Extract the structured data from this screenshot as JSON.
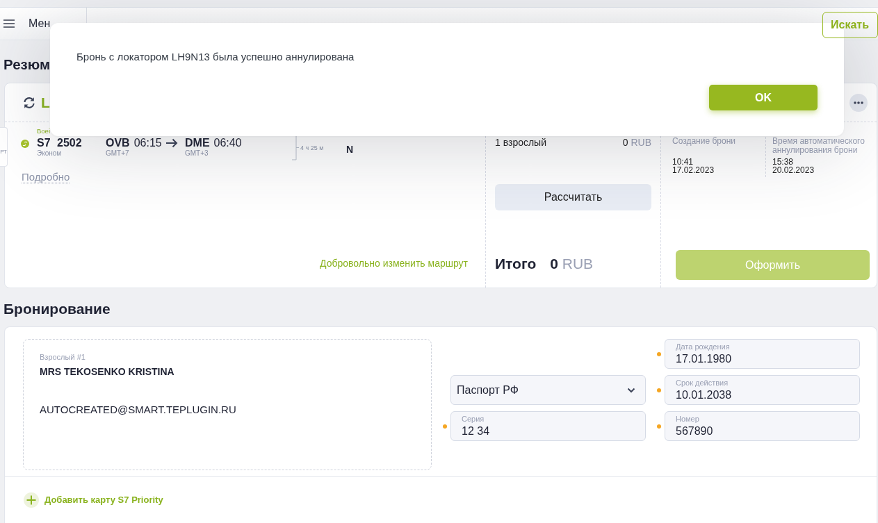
{
  "header": {
    "menu_label": "Мен",
    "search_button": "Искать"
  },
  "dialog": {
    "message": "Бронь с локатором LH9N13 была успешно аннулирована",
    "ok_button": "OK"
  },
  "summary": {
    "heading": "Резюм",
    "side_card_text": "РТ",
    "locator": "L",
    "flight": {
      "aircraft": "Boei",
      "flight_number": "S7 2502",
      "cabin": "Эконом",
      "departure": {
        "code": "OVB",
        "time": "06:15",
        "timezone": "GMT+7"
      },
      "arrival": {
        "code": "DME",
        "time": "06:40",
        "timezone": "GMT+3"
      },
      "duration": "4 ч 25 м",
      "fare_class": "N"
    },
    "details_link": "Подробно",
    "change_route_link": "Добровольно изменить маршрут",
    "fare_rows": [
      {
        "label": "1 взрослый",
        "amount": "0",
        "currency": "RUB"
      }
    ],
    "calculate_button": "Рассчитать",
    "total": {
      "label": "Итого",
      "amount": "0",
      "currency": "RUB"
    },
    "dates": [
      {
        "label": "Создание брони",
        "time": "10:41",
        "date": "17.02.2023"
      },
      {
        "label": "Время автоматического аннулирования брони",
        "time": "15:38",
        "date": "20.02.2023"
      }
    ],
    "issue_button": {
      "label": "Оформить",
      "disabled": true
    }
  },
  "booking": {
    "heading": "Бронирование",
    "passenger": {
      "category": "Взрослый #1",
      "name": "MRS TEKOSENKO KRISTINA",
      "email": "AUTOCREATED@SMART.TEPLUGIN.RU"
    },
    "left_fields": [
      {
        "kind": "select",
        "value": "Паспорт РФ",
        "required": false
      },
      {
        "kind": "text",
        "label": "Серия",
        "value": "12 34",
        "required": true
      }
    ],
    "right_fields": [
      {
        "kind": "text",
        "label": "Дата рождения",
        "value": "17.01.1980",
        "required": true
      },
      {
        "kind": "text",
        "label": "Срок действия",
        "value": "10.01.2038",
        "required": true
      },
      {
        "kind": "text",
        "label": "Номер",
        "value": "567890",
        "required": true
      }
    ],
    "add_card_link": "Добавить карту S7 Priority"
  }
}
